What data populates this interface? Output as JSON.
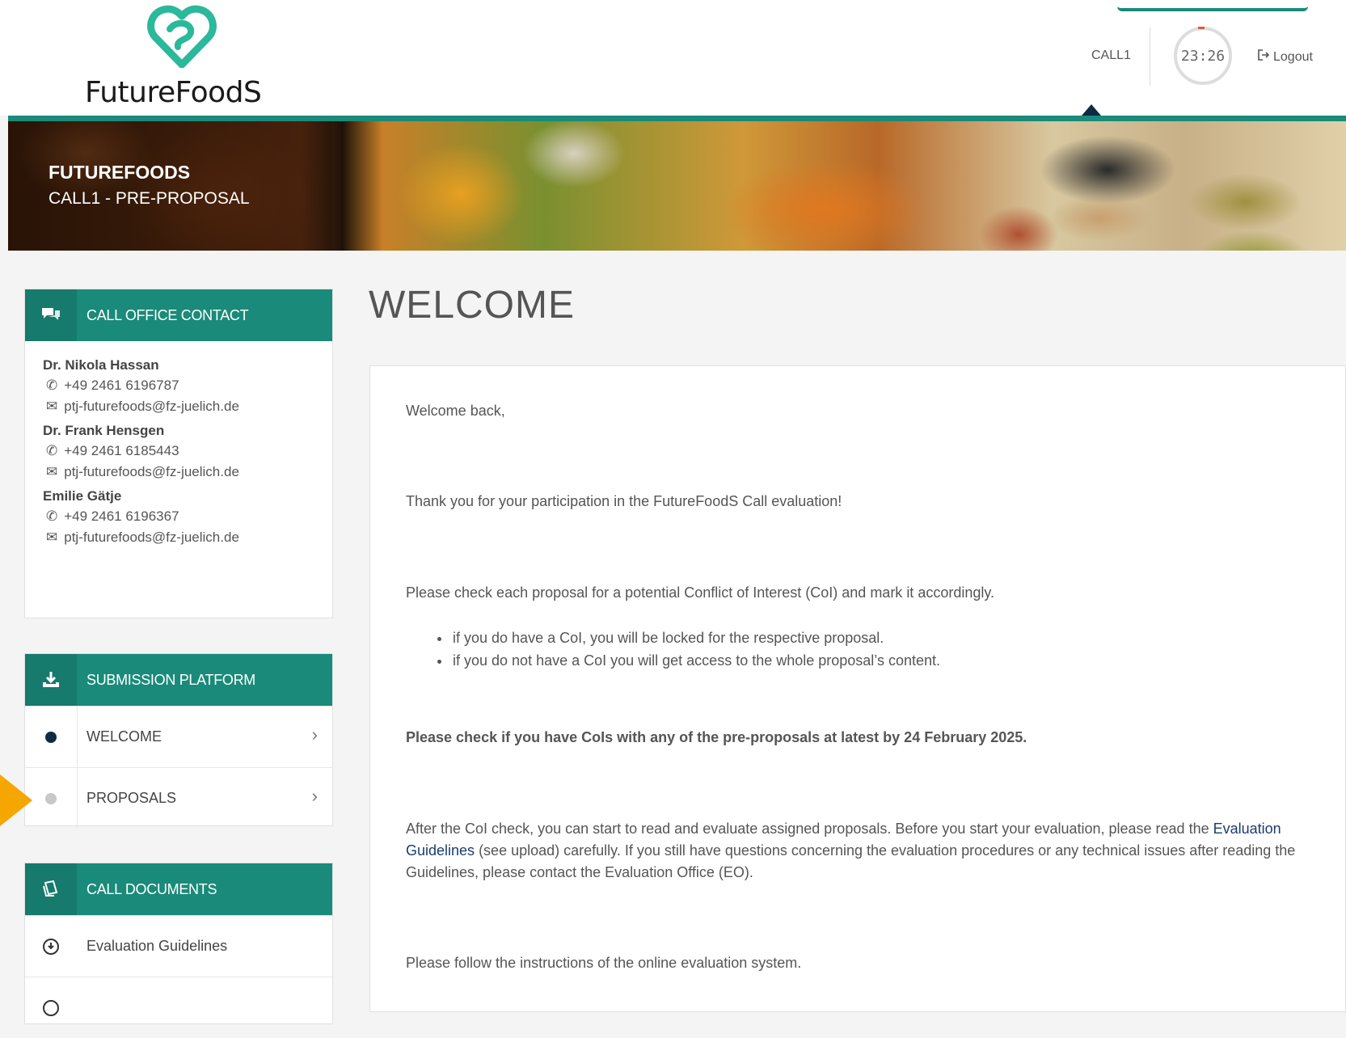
{
  "header": {
    "brand": "FutureFoodS",
    "nav_call": "CALL1",
    "timer": "23:26",
    "logout": "Logout"
  },
  "banner": {
    "title": "FUTUREFOODS",
    "subtitle": "CALL1 - PRE-PROPOSAL"
  },
  "contact_panel": {
    "title": "CALL OFFICE CONTACT",
    "contacts": [
      {
        "name": "Dr. Nikola Hassan",
        "phone": "+49 2461 6196787",
        "email": "ptj-futurefoods@fz-juelich.de"
      },
      {
        "name": "Dr. Frank Hensgen",
        "phone": "+49 2461 6185443",
        "email": "ptj-futurefoods@fz-juelich.de"
      },
      {
        "name": "Emilie Gätje",
        "phone": "+49 2461 6196367",
        "email": "ptj-futurefoods@fz-juelich.de"
      }
    ]
  },
  "submission_panel": {
    "title": "SUBMISSION PLATFORM",
    "items": [
      {
        "label": "WELCOME",
        "status_color": "#0d2b45"
      },
      {
        "label": "PROPOSALS",
        "status_color": "#c8c8c8"
      }
    ]
  },
  "documents_panel": {
    "title": "CALL DOCUMENTS",
    "items": [
      {
        "label": "Evaluation Guidelines"
      }
    ]
  },
  "main": {
    "heading": "WELCOME",
    "greeting": "Welcome back,",
    "thanks": "Thank you for your participation in the FutureFoodS Call evaluation!",
    "coi_intro": "Please check each proposal for a potential Conflict of Interest (CoI) and mark it accordingly.",
    "coi_bullets": [
      "if you do have a CoI, you will be locked for the respective proposal.",
      "if you do not have a CoI you will get access to the whole proposal’s content."
    ],
    "deadline": "Please check if you have CoIs with any of the pre-proposals at latest by 24 February 2025.",
    "after_check_1": "After the CoI check, you can start to read and evaluate assigned proposals. Before you start your evaluation, please read the",
    "after_check_link": "Evaluation Guidelines",
    "after_check_2": " (see upload) carefully. If you still have questions concerning the evaluation procedures or any technical issues after reading the Guidelines, please contact the Evaluation Office (EO).",
    "follow": "Please follow the instructions of the online evaluation system."
  },
  "colors": {
    "teal": "#1a8a7a",
    "navy": "#0d2b45",
    "highlight_arrow": "#f5a600"
  }
}
